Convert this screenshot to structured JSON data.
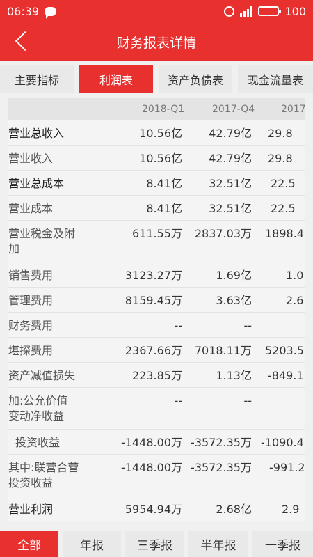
{
  "status": {
    "time": "06:39",
    "battery": "100"
  },
  "header": {
    "title": "财务报表详情"
  },
  "tabs": [
    "主要指标",
    "利润表",
    "资产负债表",
    "现金流量表"
  ],
  "table": {
    "periods": [
      "2018-Q1",
      "2017-Q4",
      "2017"
    ],
    "rows": [
      {
        "label": "营业总收入",
        "values": [
          "10.56亿",
          "42.79亿",
          "29.8"
        ]
      },
      {
        "label": "营业收入",
        "values": [
          "10.56亿",
          "42.79亿",
          "29.8"
        ]
      },
      {
        "label": "营业总成本",
        "values": [
          "8.41亿",
          "32.51亿",
          "22.5"
        ]
      },
      {
        "label": "营业成本",
        "values": [
          "8.41亿",
          "32.51亿",
          "22.5"
        ]
      },
      {
        "label": "营业税金及附加",
        "values": [
          "611.55万",
          "2837.03万",
          "1898.4"
        ]
      },
      {
        "label": "销售费用",
        "values": [
          "3123.27万",
          "1.69亿",
          "1.0"
        ]
      },
      {
        "label": "管理费用",
        "values": [
          "8159.45万",
          "3.63亿",
          "2.6"
        ]
      },
      {
        "label": "财务费用",
        "values": [
          "--",
          "--",
          ""
        ]
      },
      {
        "label": "堪探费用",
        "values": [
          "2367.66万",
          "7018.11万",
          "5203.5"
        ]
      },
      {
        "label": "资产减值损失",
        "values": [
          "223.85万",
          "1.13亿",
          "-849.1"
        ]
      },
      {
        "label": "加:公允价值变动净收益",
        "values": [
          "--",
          "--",
          ""
        ]
      },
      {
        "label": "投资收益",
        "values": [
          "-1448.00万",
          "-3572.35万",
          "-1090.4"
        ]
      },
      {
        "label": "其中:联营合营投资收益",
        "values": [
          "-1448.00万",
          "-3572.35万",
          "-991.2"
        ]
      },
      {
        "label": "营业利润",
        "values": [
          "5954.94万",
          "2.68亿",
          "2.9"
        ]
      }
    ]
  },
  "bottom_tabs": [
    "全部",
    "年报",
    "三季报",
    "半年报",
    "一季报"
  ]
}
